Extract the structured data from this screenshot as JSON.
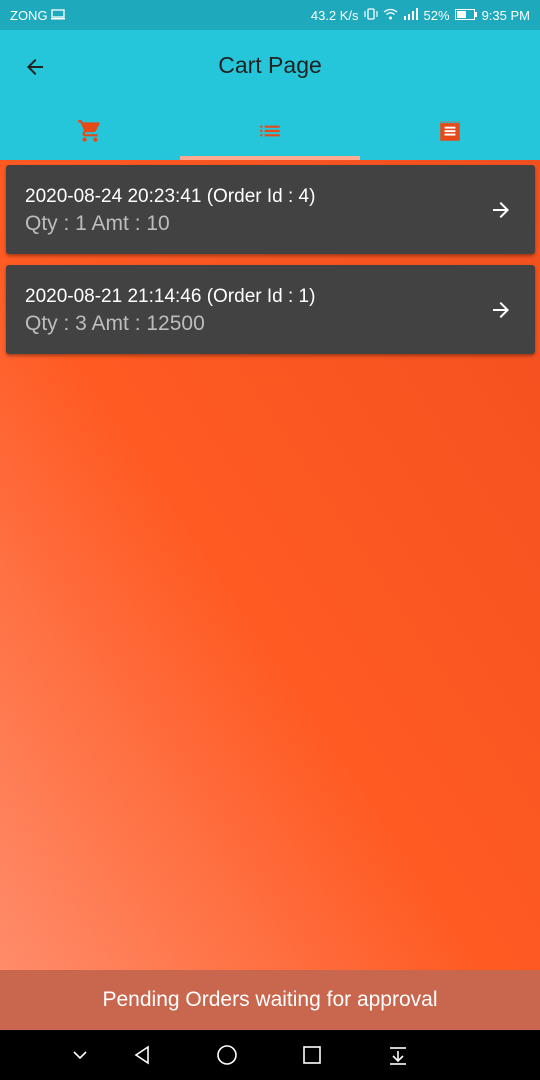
{
  "status_bar": {
    "carrier": "ZONG",
    "speed": "43.2 K/s",
    "battery": "52%",
    "time": "9:35 PM"
  },
  "app_bar": {
    "title": "Cart Page",
    "tabs": [
      {
        "icon": "cart-icon"
      },
      {
        "icon": "list-icon"
      },
      {
        "icon": "receipt-icon"
      }
    ]
  },
  "colors": {
    "app_bar": "#26c6da",
    "status_bar": "#1fa9bd",
    "card": "#424242",
    "tab_icon": "#e64a19",
    "footer": "#c9674e"
  },
  "orders": [
    {
      "title": "2020-08-24 20:23:41 (Order Id : 4)",
      "details": "Qty : 1 Amt : 10"
    },
    {
      "title": "2020-08-21 21:14:46 (Order Id : 1)",
      "details": "Qty : 3 Amt : 12500"
    }
  ],
  "footer": {
    "text": "Pending Orders waiting for approval"
  }
}
